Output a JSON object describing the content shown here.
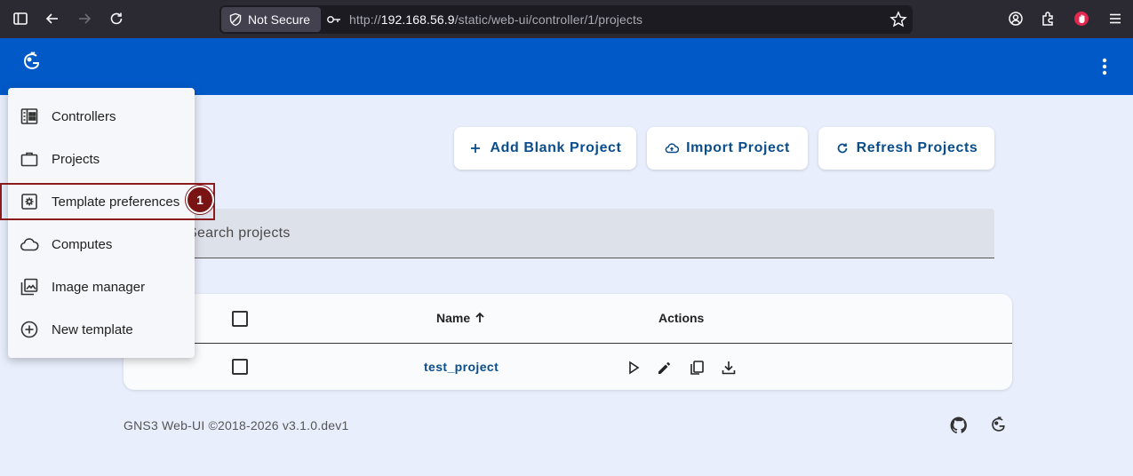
{
  "browser": {
    "security_label": "Not Secure",
    "url_host": "192.168.56.9",
    "url_prefix": "http://",
    "url_path": "/static/web-ui/controller/1/projects"
  },
  "page": {
    "title": "ects",
    "buttons": {
      "add_blank": "Add Blank Project",
      "import": "Import Project",
      "refresh": "Refresh Projects"
    },
    "search": {
      "placeholder": "Search projects"
    },
    "table": {
      "headers": {
        "name": "Name",
        "actions": "Actions"
      },
      "rows": [
        {
          "name": "test_project"
        }
      ]
    },
    "footer": "GNS3 Web-UI ©2018-2026 v3.1.0.dev1"
  },
  "menu": {
    "items": [
      {
        "label": "Controllers",
        "icon": "controllers-icon"
      },
      {
        "label": "Projects",
        "icon": "briefcase-icon"
      },
      {
        "label": "Template preferences",
        "icon": "settings-box-icon"
      },
      {
        "label": "Computes",
        "icon": "cloud-icon"
      },
      {
        "label": "Image manager",
        "icon": "image-library-icon"
      },
      {
        "label": "New template",
        "icon": "add-circle-icon"
      }
    ]
  },
  "annotation": {
    "badge": "1",
    "color": "#7a1414"
  },
  "colors": {
    "toolbar": "#0059c7",
    "link": "#0a4d8c",
    "background": "#e8eefc"
  }
}
